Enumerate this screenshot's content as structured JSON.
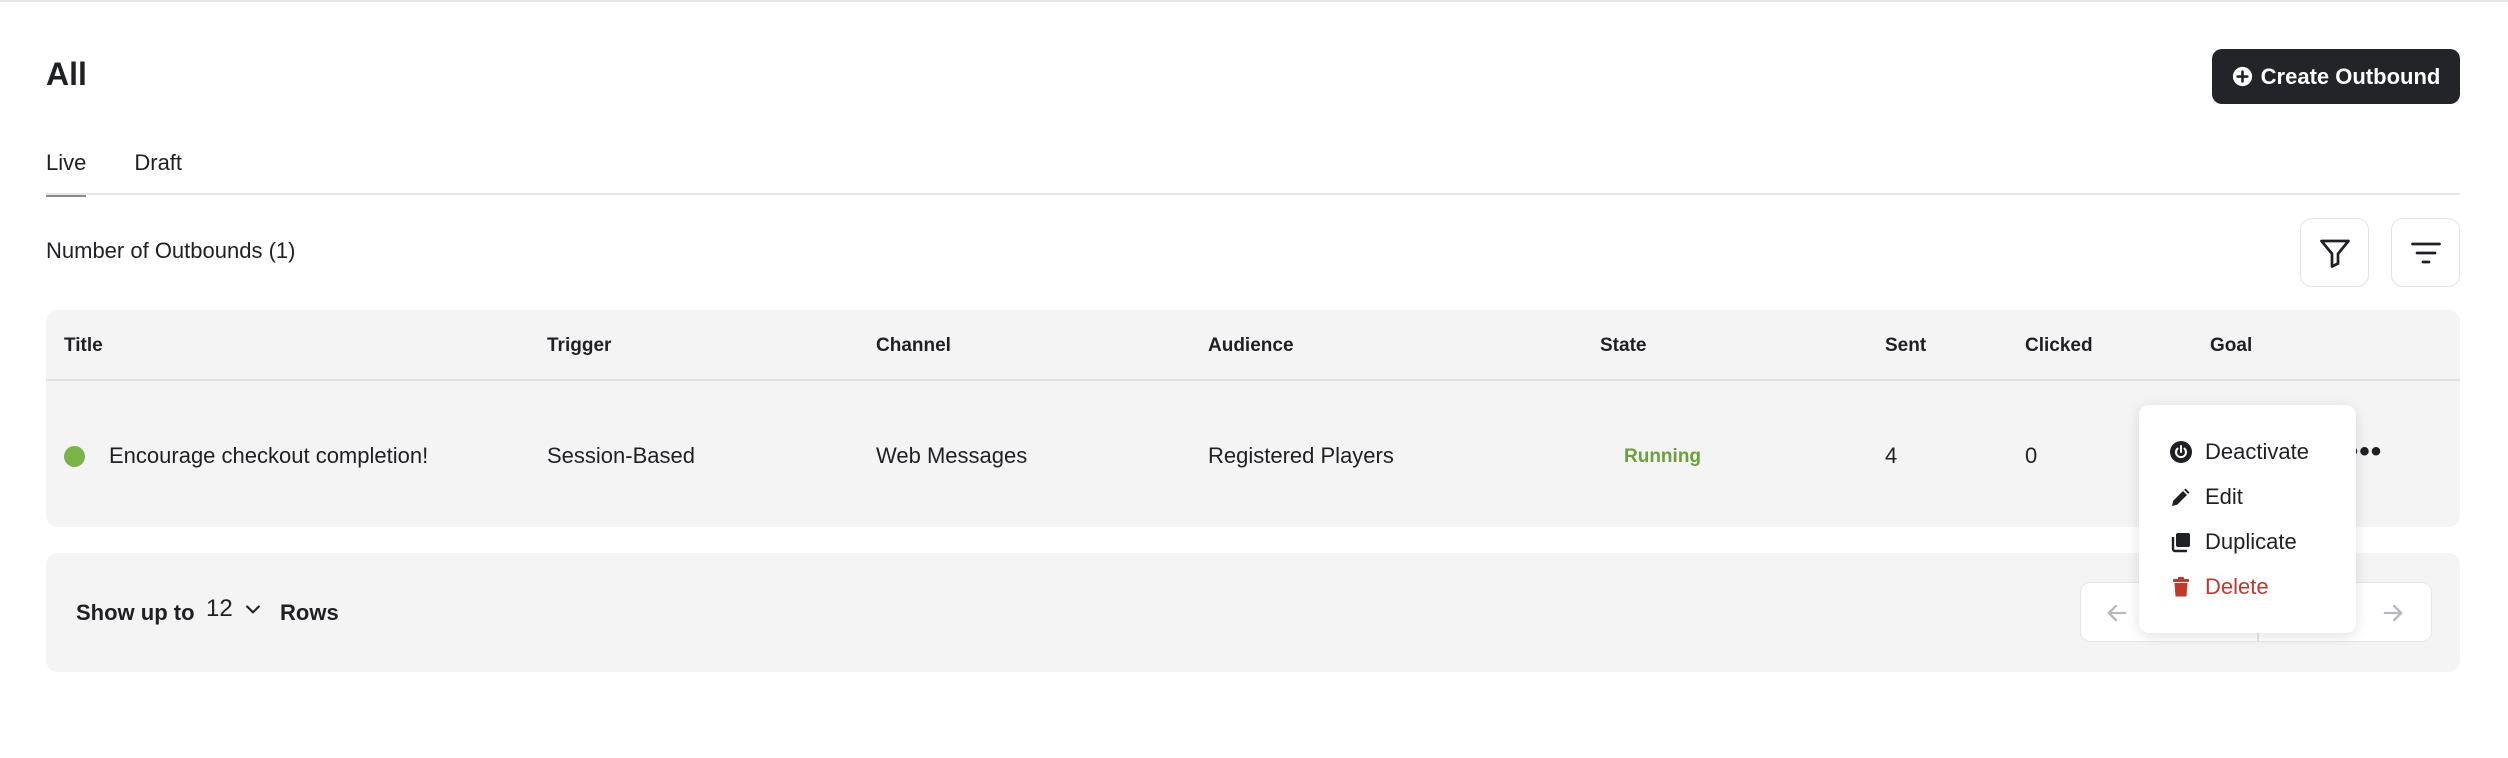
{
  "page": {
    "title": "All",
    "create_button_label": "Create Outbound"
  },
  "tabs": [
    {
      "label": "Live",
      "active": true
    },
    {
      "label": "Draft",
      "active": false
    }
  ],
  "summary": {
    "count_label": "Number of Outbounds (1)"
  },
  "toolbar": {
    "filter_icon": "filter-icon",
    "sort_icon": "sort-icon"
  },
  "table": {
    "columns": [
      "Title",
      "Trigger",
      "Channel",
      "Audience",
      "State",
      "Sent",
      "Clicked",
      "Goal"
    ],
    "rows": [
      {
        "status_color": "#7bb349",
        "title": "Encourage checkout completion!",
        "trigger": "Session-Based",
        "channel": "Web Messages",
        "audience": "Registered Players",
        "state": "Running",
        "sent": "4",
        "clicked": "0",
        "more": "•••"
      }
    ]
  },
  "pagination": {
    "show_label": "Show up to",
    "rows_value": "12",
    "rows_label": "Rows"
  },
  "context_menu": {
    "items": [
      {
        "label": "Deactivate",
        "icon": "power-icon"
      },
      {
        "label": "Edit",
        "icon": "pencil-icon"
      },
      {
        "label": "Duplicate",
        "icon": "duplicate-icon"
      },
      {
        "label": "Delete",
        "icon": "trash-icon",
        "color": "#c0392b"
      }
    ]
  },
  "colors": {
    "primary_button": "#232427",
    "running_state": "#6aa13b",
    "danger": "#c0392b"
  }
}
